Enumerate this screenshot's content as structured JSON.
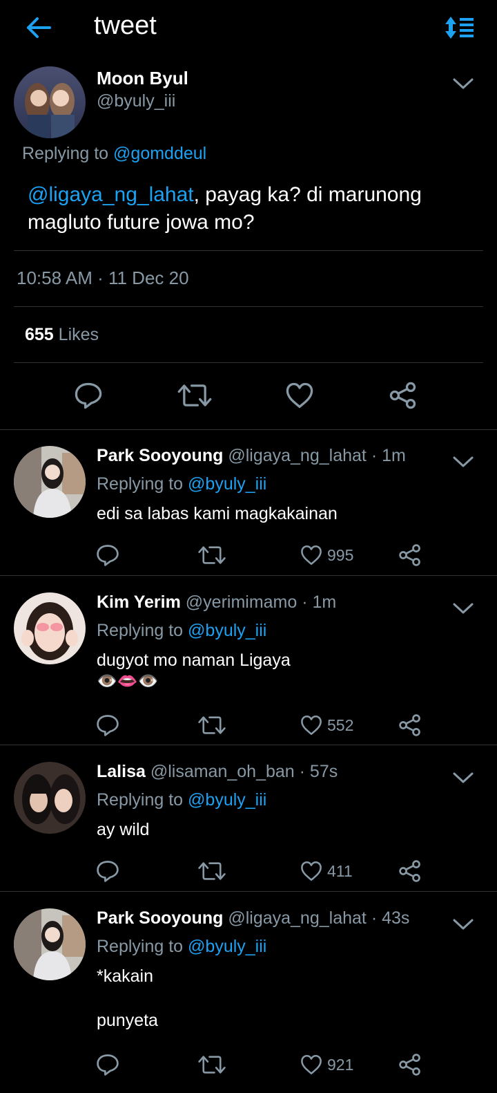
{
  "header": {
    "title": "tweet",
    "accent_color": "#1da1f2"
  },
  "main_tweet": {
    "name": "Moon Byul",
    "handle": "@byuly_iii",
    "replying_prefix": "Replying to ",
    "replying_to": "@gomddeul",
    "mention": "@ligaya_ng_lahat",
    "text": ", payag ka? di marunong magluto future jowa mo?",
    "timestamp": "10:58 AM · 11 Dec 20",
    "likes_count": "655",
    "likes_label": "Likes"
  },
  "replies": [
    {
      "name": "Park Sooyoung",
      "handle": "@ligaya_ng_lahat",
      "time": "· 1m",
      "replying_prefix": "Replying to ",
      "replying_to": "@byuly_iii",
      "text": "edi sa labas kami magkakainan",
      "likes": "995"
    },
    {
      "name": "Kim Yerim",
      "handle": "@yerimimamo",
      "time": "· 1m",
      "replying_prefix": "Replying to ",
      "replying_to": "@byuly_iii",
      "text": "dugyot mo naman Ligaya",
      "emoji": "👁️👄👁️",
      "likes": "552"
    },
    {
      "name": "Lalisa",
      "handle": "@lisaman_oh_ban",
      "time": "· 57s",
      "replying_prefix": "Replying to ",
      "replying_to": "@byuly_iii",
      "text": "ay wild",
      "likes": "411"
    },
    {
      "name": "Park Sooyoung",
      "handle": "@ligaya_ng_lahat",
      "time": "· 43s",
      "replying_prefix": "Replying to ",
      "replying_to": "@byuly_iii",
      "text": "*kakain\n\npunyeta",
      "likes": "921"
    }
  ]
}
